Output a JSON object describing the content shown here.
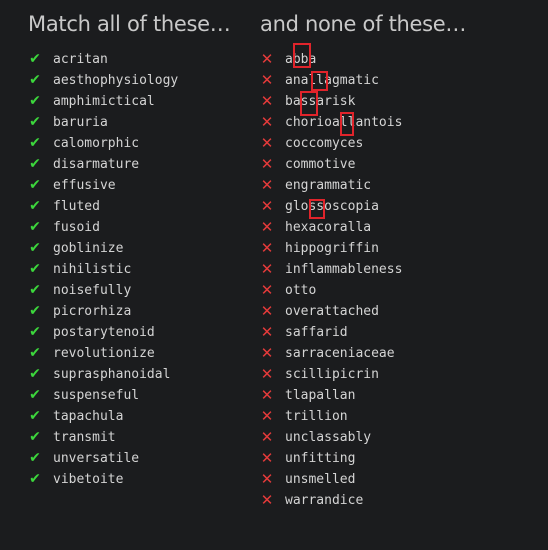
{
  "match": {
    "heading": "Match all of these…",
    "words": [
      "acritan",
      "aesthophysiology",
      "amphimictical",
      "baruria",
      "calomorphic",
      "disarmature",
      "effusive",
      "fluted",
      "fusoid",
      "goblinize",
      "nihilistic",
      "noisefully",
      "picrorhiza",
      "postarytenoid",
      "revolutionize",
      "suprasphanoidal",
      "suspenseful",
      "tapachula",
      "transmit",
      "unversatile",
      "vibetoite"
    ]
  },
  "none": {
    "heading": "and none of these…",
    "words": [
      "abba",
      "anallagmatic",
      "bassarisk",
      "chorioallantois",
      "coccomyces",
      "commotive",
      "engrammatic",
      "glossoscopia",
      "hexacoralla",
      "hippogriffin",
      "inflammableness",
      "otto",
      "overattached",
      "saffarid",
      "sarraceniaceae",
      "scillipicrin",
      "tlapallan",
      "trillion",
      "unclassably",
      "unfitting",
      "unsmelled",
      "warrandice"
    ]
  },
  "colors": {
    "background": "#1b1c1e",
    "check": "#3cd63c",
    "cross": "#e43a3a",
    "highlight": "#e0242b"
  },
  "icons": {
    "match": "check-icon",
    "none": "cross-icon"
  }
}
